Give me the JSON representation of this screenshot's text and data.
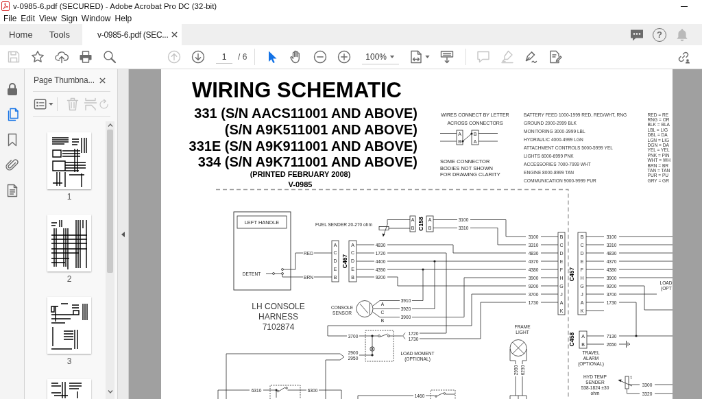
{
  "window": {
    "title": "v-0985-6.pdf (SECURED) - Adobe Acrobat Pro DC (32-bit)"
  },
  "menu": [
    "File",
    "Edit",
    "View",
    "Sign",
    "Window",
    "Help"
  ],
  "tabs": [
    {
      "label": "Home",
      "kind": "nav",
      "selected": false
    },
    {
      "label": "Tools",
      "kind": "nav",
      "selected": false
    },
    {
      "label": "v-0985-6.pdf (SEC...",
      "kind": "document",
      "selected": true
    }
  ],
  "header_icons": [
    {
      "kind": "chat"
    },
    {
      "kind": "help",
      "glyph": "?"
    },
    {
      "kind": "bell"
    }
  ],
  "toolbar": {
    "left": [
      {
        "kind": "save",
        "disabled": true
      },
      {
        "kind": "star",
        "disabled": false
      },
      {
        "kind": "upload",
        "disabled": false
      },
      {
        "kind": "print",
        "disabled": false
      },
      {
        "kind": "find",
        "disabled": false
      }
    ],
    "nav": [
      {
        "kind": "prev",
        "disabled": true
      },
      {
        "kind": "next",
        "disabled": false
      }
    ],
    "page": "1",
    "page_total": "/ 6",
    "modes": [
      {
        "kind": "select",
        "selected": true
      },
      {
        "kind": "hand",
        "selected": false
      }
    ],
    "zoom_buttons": [
      {
        "kind": "zoom-out"
      },
      {
        "kind": "zoom-in"
      }
    ],
    "zoom": "100%",
    "view": [
      {
        "kind": "fit"
      },
      {
        "kind": "scroll"
      }
    ],
    "annotate": [
      {
        "kind": "comment",
        "disabled": true
      },
      {
        "kind": "highlight",
        "disabled": true
      },
      {
        "kind": "sign",
        "disabled": false
      },
      {
        "kind": "fill-sign",
        "disabled": false
      }
    ],
    "share": [
      {
        "kind": "share"
      }
    ]
  },
  "sidebar": {
    "items": [
      {
        "kind": "lock",
        "selected": false
      },
      {
        "kind": "pages",
        "selected": true
      },
      {
        "kind": "bookmark",
        "selected": false
      },
      {
        "kind": "attachment",
        "selected": false
      },
      {
        "kind": "document",
        "selected": false
      }
    ]
  },
  "thumbnail_panel": {
    "title": "Page Thumbna...",
    "tools": [
      {
        "kind": "options",
        "disabled": false
      },
      {
        "kind": "delete",
        "disabled": true
      },
      {
        "kind": "insert",
        "disabled": true
      },
      {
        "kind": "rotate",
        "disabled": true
      }
    ],
    "thumbnails": [
      {
        "label": "1"
      },
      {
        "label": "2"
      },
      {
        "label": "3"
      }
    ],
    "more_below": true
  },
  "document": {
    "title": "WIRING SCHEMATIC",
    "models": [
      "331 (S/N AACS11001 AND ABOVE)",
      "(S/N A9K511001 AND ABOVE)",
      "331E (S/N A9K911001 AND ABOVE)",
      "334 (S/N A9K711001 AND ABOVE)"
    ],
    "printed": "(PRINTED FEBRUARY 2008)",
    "number": "V-0985",
    "legend": {
      "heading": [
        "WIRES CONNECT BY LETTER",
        "ACROSS CONNECTORS"
      ],
      "left_pins": [
        "A",
        "B"
      ],
      "right_pins": [
        "B",
        "A"
      ],
      "note": [
        "SOME CONNECTOR",
        "BODIES NOT SHOWN",
        "FOR DRAWING CLARITY"
      ]
    },
    "wire_ranges": [
      "BATTERY FEED 1000-1999 RED, RED/WHT, RNG",
      "GROUND 2000-2999 BLK",
      "MONITORING 3000-3999 LBL",
      "HYDRAULIC 4000-4999 LGN",
      "ATTACHMENT CONTROLS 5000-5999 YEL",
      "LIGHTS 6000-6999 PNK",
      "ACCESSORIES 7000-7999 WHT",
      "ENGINE 8000-8999 TAN",
      "COMMUNICATION 9000-9999 PUR"
    ],
    "color_codes": [
      "RED = RE",
      "RNG = OR",
      "BLK = BLA",
      "LBL = LIG",
      "DBL = DA",
      "LGN = LIG",
      "DGN = DA",
      "YEL = YEL",
      "PNK = PIN",
      "WHT = WH",
      "BRN = BR",
      "TAN = TAN",
      "PUR = PU",
      "GRY = GR"
    ],
    "left_handle": {
      "label": "LEFT HANDLE",
      "switch": "DETENT"
    },
    "harness": [
      "LH CONSOLE",
      "HARNESS",
      "7102874"
    ],
    "fuel_sender": "FUEL SENDER 20-270 ohm",
    "connectors": [
      {
        "name": "C467",
        "left_pins": [
          "A",
          "C",
          "D",
          "E",
          "B"
        ],
        "right_pins": [
          "A",
          "C",
          "D",
          "E",
          "B"
        ]
      },
      {
        "name": "C158",
        "left_pins": [
          "A",
          "B"
        ],
        "right_pins": [
          "A",
          "B"
        ]
      },
      {
        "name": "C457",
        "left_pins": [
          "B",
          "C",
          "D",
          "E",
          "F",
          "H",
          "G",
          "J",
          "A",
          "K"
        ],
        "right_pins": [
          "B",
          "C",
          "D",
          "E",
          "F",
          "H",
          "G",
          "J",
          "A",
          "K"
        ]
      },
      {
        "name": "C458",
        "left_pins": [
          "A",
          "B"
        ]
      }
    ],
    "console_sensor": {
      "label": [
        "CONSOLE",
        "SENSOR"
      ],
      "pins": [
        "A",
        "C",
        "B"
      ]
    },
    "load_moment": [
      "LOAD MOMENT",
      "(OPTIONAL)"
    ],
    "frame_light": [
      "FRAME",
      "LIGHT"
    ],
    "travel_alarm": [
      "TRAVEL",
      "ALARM",
      "(OPTIONAL)"
    ],
    "hyd_temp_sender": {
      "label": [
        "HYD TEMP",
        "SENDER",
        "538-1824 ±30",
        "ohm"
      ],
      "mark": "t"
    },
    "cut_label": [
      "LOAD",
      "(OPT"
    ],
    "wire_labels": [
      "RED",
      "BRN",
      "4830",
      "1720",
      "4400",
      "4390",
      "9200",
      "3100",
      "3310",
      "3100",
      "3310",
      "4830",
      "4370",
      "4380",
      "3900",
      "9200",
      "3700",
      "1730",
      "3100",
      "3310",
      "4830",
      "4370",
      "4380",
      "3900",
      "9200",
      "3700",
      "1730",
      "3910",
      "3920",
      "3900",
      "1720",
      "1730",
      "3700",
      "2900",
      "2950",
      "6310",
      "6300",
      "1460",
      "7130",
      "2650",
      "2950",
      "6230",
      "3300",
      "3320"
    ]
  }
}
